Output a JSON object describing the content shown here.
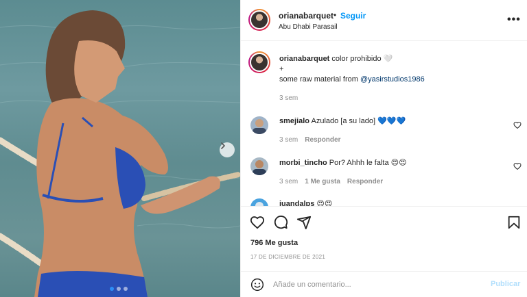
{
  "header": {
    "username": "orianabarquet",
    "separator": "•",
    "follow_label": "Seguir",
    "location": "Abu Dhabi Parasail",
    "more_icon": "more-horizontal-icon",
    "more_label": "•••"
  },
  "caption": {
    "username": "orianabarquet",
    "line1": "color prohibido 🤍",
    "line2": "+",
    "line3_prefix": "some raw material from ",
    "mention": "@yasirstudios1986",
    "time": "3 sem"
  },
  "comments": [
    {
      "username": "smejialo",
      "text": "Azulado [a su lado] 💙💙💙",
      "time": "3 sem",
      "reply_label": "Responder",
      "likes_label": ""
    },
    {
      "username": "morbi_tincho",
      "text": "Por? Ahhh le falta 😍😍",
      "time": "3 sem",
      "likes_label": "1 Me gusta",
      "reply_label": "Responder"
    },
    {
      "username": "juandalps",
      "text": "😍😍",
      "time": "",
      "reply_label": "",
      "likes_label": ""
    }
  ],
  "actions": {
    "like_icon": "heart-icon",
    "comment_icon": "comment-icon",
    "share_icon": "send-icon",
    "save_icon": "bookmark-icon",
    "likes": "796 Me gusta",
    "date": "17 DE DICIEMBRE DE 2021"
  },
  "add_comment": {
    "emoji_icon": "emoji-icon",
    "placeholder": "Añade un comentario...",
    "post_label": "Publicar"
  },
  "carousel": {
    "current": 1,
    "total": 3
  },
  "colors": {
    "accent": "#0095f6",
    "link": "#00376b",
    "muted": "#8e8e8e",
    "post_disabled": "#b2dffc",
    "carousel_active": "#2e8ef5"
  }
}
